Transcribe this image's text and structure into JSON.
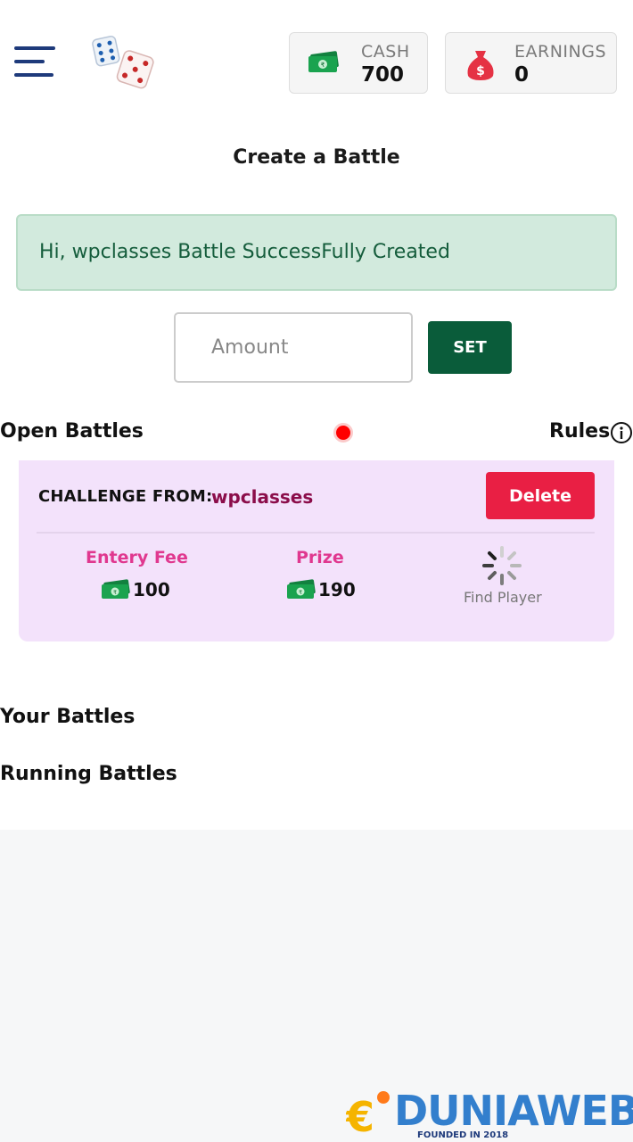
{
  "header": {
    "menu_icon": "hamburger-icon",
    "logo": "dice-logo",
    "cash": {
      "label": "CASH",
      "value": "700",
      "icon": "cash-icon"
    },
    "earnings": {
      "label": "EARNINGS",
      "value": "0",
      "icon": "money-bag-icon"
    }
  },
  "create": {
    "title": "Create a Battle",
    "alert": "Hi, wpclasses Battle SuccessFully Created",
    "amount_placeholder": "Amount",
    "set_label": "SET"
  },
  "open_battles": {
    "title": "Open Battles",
    "rules_label": "Rules",
    "card": {
      "challenge_label": "CHALLENGE FROM:",
      "challenger": "wpclasses",
      "delete_label": "Delete",
      "entry_fee_label": "Entery Fee",
      "entry_fee": "100",
      "prize_label": "Prize",
      "prize": "190",
      "find_player_label": "Find Player"
    }
  },
  "your_battles_title": "Your Battles",
  "running_battles_title": "Running Battles",
  "watermark": {
    "text": "DUNIAWEB",
    "sub": "FOUNDED IN 2018"
  },
  "colors": {
    "accent_green": "#0a5c3a",
    "alert_bg": "#d2eadd",
    "delete_red": "#e91f44",
    "card_bg": "#f3e2fb",
    "challenger": "#8b0d4a",
    "stat_label": "#e0388f"
  }
}
